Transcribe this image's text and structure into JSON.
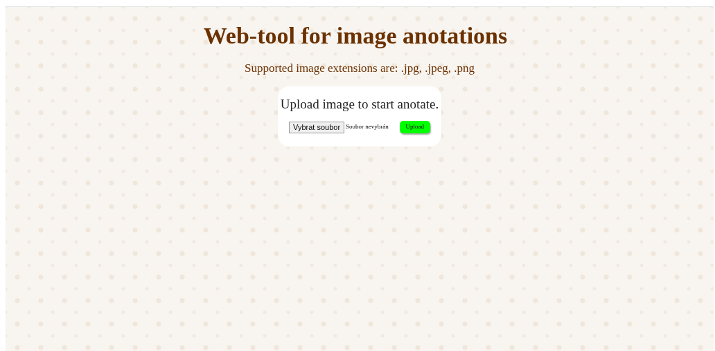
{
  "title": "Web-tool for image anotations",
  "subtitle": "Supported image extensions are: .jpg, .jpeg, .png",
  "upload_card": {
    "heading": "Upload image to start anotate.",
    "file_button": "Vybrat soubor",
    "file_status": "Soubor nevybrán",
    "upload_button": "Upload"
  }
}
